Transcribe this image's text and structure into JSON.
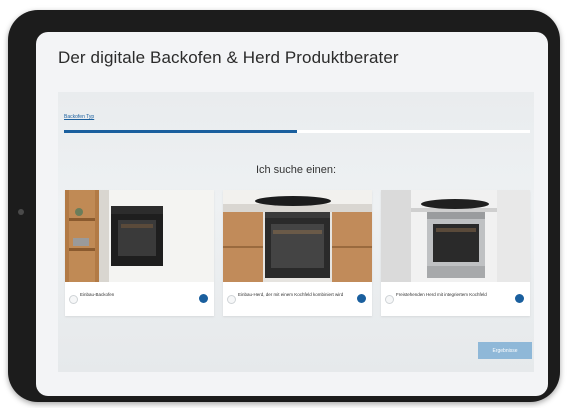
{
  "page": {
    "title": "Der digitale Backofen & Herd Produktberater"
  },
  "progress": {
    "step_label": "Backofen Typ",
    "fraction": 0.5
  },
  "question": "Ich suche einen:",
  "options": [
    {
      "label": "Einbau-Backofen",
      "selected": false
    },
    {
      "label": "Einbau-Herd, der mit einem Kochfeld kombiniert wird",
      "selected": false
    },
    {
      "label": "Freistehenden Herd mit integriertem Kochfeld",
      "selected": false
    }
  ],
  "results_button": {
    "label": "Ergebnisse",
    "enabled": false
  },
  "colors": {
    "accent": "#1a5f9e",
    "button_disabled": "#8fb8d8",
    "tablet_frame": "#1c1c1c"
  },
  "icons": [
    "radio-button-icon",
    "info-icon"
  ]
}
